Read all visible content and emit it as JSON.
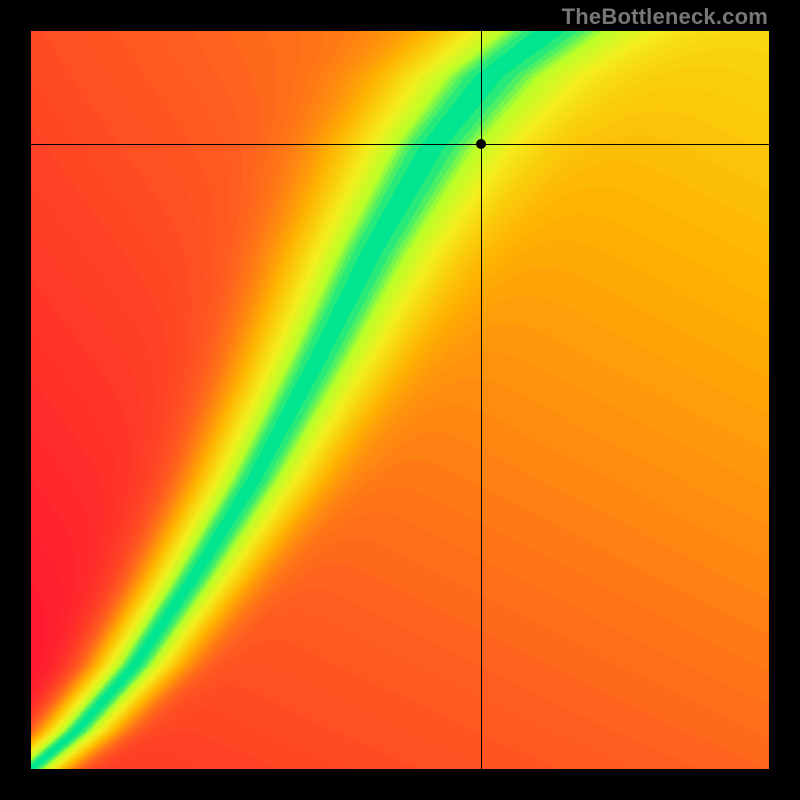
{
  "watermark": "TheBottleneck.com",
  "chart_data": {
    "type": "heatmap",
    "title": "",
    "xlabel": "",
    "ylabel": "",
    "xlim": [
      0,
      100
    ],
    "ylim": [
      0,
      100
    ],
    "grid": false,
    "legend": false,
    "description": "Bottleneck heatmap. Color encodes match quality (green = optimal, yellow = marginal, red = severe bottleneck). Overlaid crosshair marks the evaluated configuration.",
    "color_stops": [
      {
        "t": 0.0,
        "hex": "#ff0035"
      },
      {
        "t": 0.35,
        "hex": "#ff5d1f"
      },
      {
        "t": 0.6,
        "hex": "#ffb500"
      },
      {
        "t": 0.8,
        "hex": "#f3ef1e"
      },
      {
        "t": 0.92,
        "hex": "#b9ff28"
      },
      {
        "t": 1.0,
        "hex": "#00e58f"
      }
    ],
    "ridge_points": [
      {
        "x": 0.0,
        "y": 0.0
      },
      {
        "x": 6.0,
        "y": 5.0
      },
      {
        "x": 14.0,
        "y": 14.0
      },
      {
        "x": 22.0,
        "y": 26.0
      },
      {
        "x": 30.0,
        "y": 39.0
      },
      {
        "x": 38.0,
        "y": 54.0
      },
      {
        "x": 46.0,
        "y": 70.0
      },
      {
        "x": 54.0,
        "y": 84.0
      },
      {
        "x": 62.0,
        "y": 94.0
      },
      {
        "x": 70.0,
        "y": 100.0
      }
    ],
    "ridge_half_width_x": 7.0,
    "background_gradient_angle_deg": 135,
    "crosshair": {
      "x": 61.0,
      "y": 84.7
    },
    "marker": {
      "x": 61.0,
      "y": 84.7
    }
  }
}
